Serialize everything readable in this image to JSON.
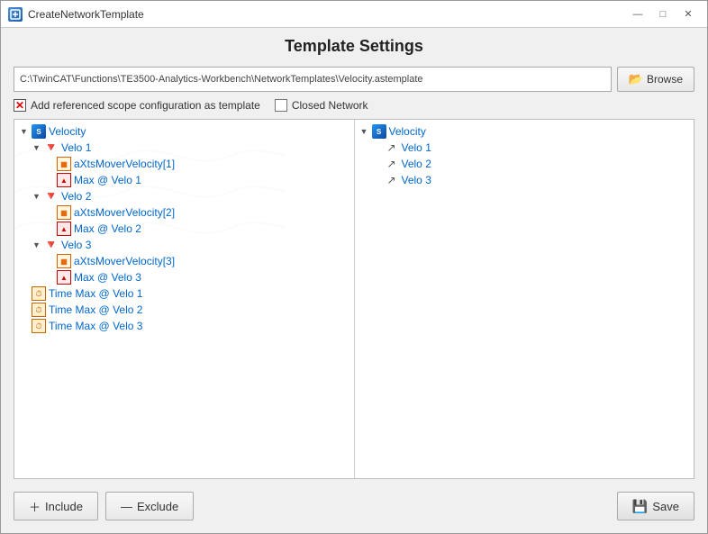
{
  "window": {
    "title": "CreateNetworkTemplate"
  },
  "title_bar": {
    "title": "CreateNetworkTemplate",
    "minimize_label": "—",
    "maximize_label": "□",
    "close_label": "✕"
  },
  "page": {
    "heading": "Template Settings"
  },
  "path": {
    "value": "C:\\TwinCAT\\Functions\\TE3500-Analytics-Workbench\\NetworkTemplates\\Velocity.astemplate",
    "browse_label": "Browse"
  },
  "options": {
    "scope_config_label": "Add referenced scope configuration as template",
    "closed_network_label": "Closed Network",
    "scope_checked": true,
    "closed_network_checked": false
  },
  "left_tree": {
    "root": {
      "label": "Velocity",
      "children": [
        {
          "label": "Velo 1",
          "children": [
            {
              "label": "aXtsMoverVelocity[1]",
              "type": "array"
            },
            {
              "label": "Max @ Velo 1",
              "type": "max"
            }
          ]
        },
        {
          "label": "Velo 2",
          "children": [
            {
              "label": "aXtsMoverVelocity[2]",
              "type": "array"
            },
            {
              "label": "Max @ Velo 2",
              "type": "max"
            }
          ]
        },
        {
          "label": "Velo 3",
          "children": [
            {
              "label": "aXtsMoverVelocity[3]",
              "type": "array"
            },
            {
              "label": "Max @ Velo 3",
              "type": "max"
            }
          ]
        },
        {
          "label": "Time Max @ Velo 1",
          "type": "time"
        },
        {
          "label": "Time Max @ Velo 2",
          "type": "time"
        },
        {
          "label": "Time Max @ Velo 3",
          "type": "time"
        }
      ]
    }
  },
  "right_tree": {
    "root": {
      "label": "Velocity",
      "children": [
        {
          "label": "Velo 1"
        },
        {
          "label": "Velo 2"
        },
        {
          "label": "Velo 3"
        }
      ]
    }
  },
  "footer": {
    "include_label": "Include",
    "exclude_label": "Exclude",
    "save_label": "Save"
  }
}
